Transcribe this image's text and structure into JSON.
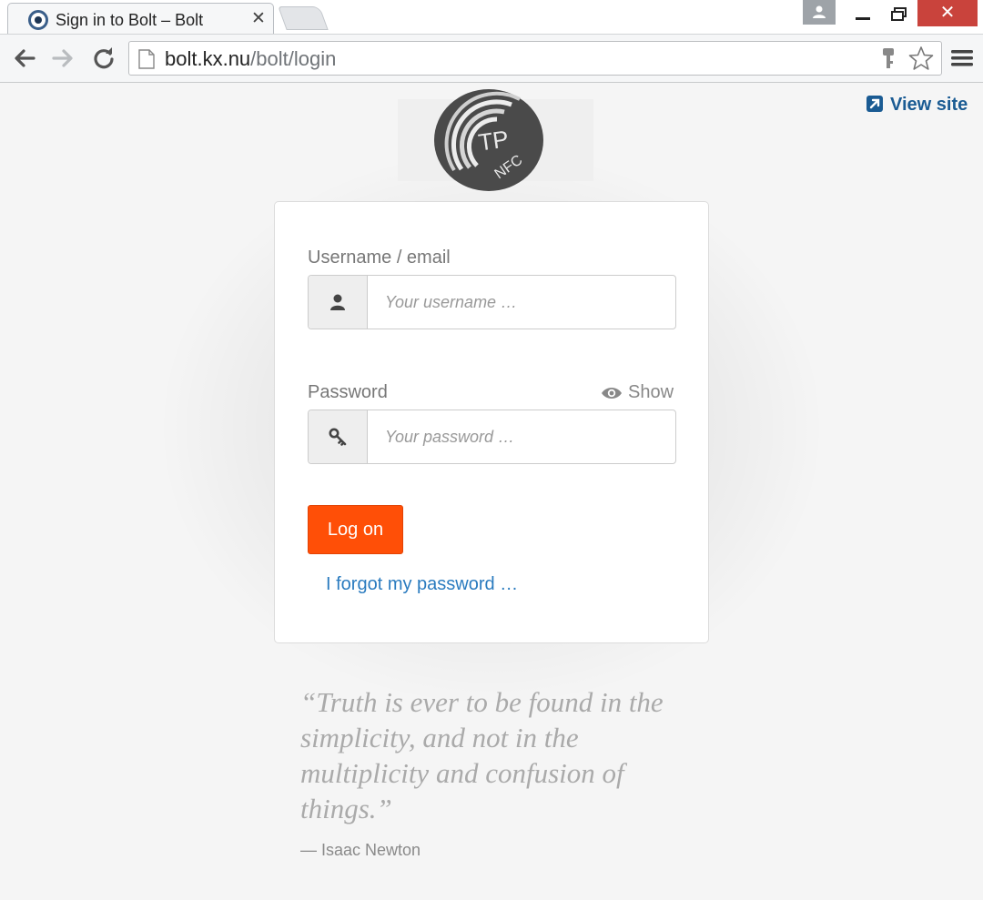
{
  "browser": {
    "tab_title": "Sign in to Bolt – Bolt",
    "tab_close": "✕",
    "window_close": "✕",
    "url_host": "bolt.kx.nu",
    "url_path": "/bolt/login"
  },
  "header": {
    "view_site_label": "View site"
  },
  "logo": {
    "text_tp": "TP",
    "text_nfc": "NFC"
  },
  "login": {
    "username_label": "Username / email",
    "username_placeholder": "Your username …",
    "password_label": "Password",
    "show_label": "Show",
    "password_placeholder": "Your password …",
    "logon_label": "Log on",
    "forgot_label": "I forgot my password …"
  },
  "quote": {
    "text": "“Truth is ever to be found in the simplicity, and not in the multiplicity and confusion of things.”",
    "author": "— Isaac Newton"
  },
  "colors": {
    "accent_button": "#ff4f07",
    "link": "#2a7bbf",
    "view_site": "#1a5b93"
  }
}
